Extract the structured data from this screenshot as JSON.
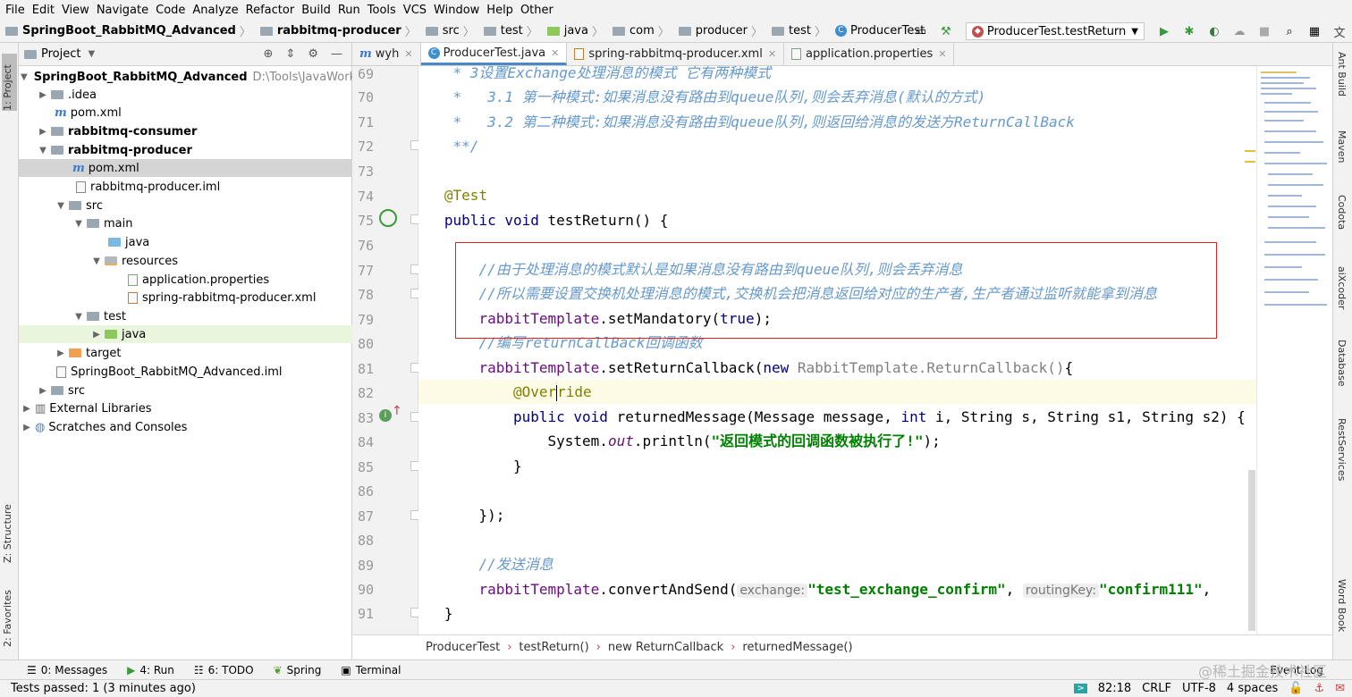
{
  "menu": [
    "File",
    "Edit",
    "View",
    "Navigate",
    "Code",
    "Analyze",
    "Refactor",
    "Build",
    "Run",
    "Tools",
    "VCS",
    "Window",
    "Help",
    "Other"
  ],
  "breadcrumbs": [
    "SpringBoot_RabbitMQ_Advanced",
    "rabbitmq-producer",
    "src",
    "test",
    "java",
    "com",
    "producer",
    "test",
    "ProducerTest"
  ],
  "run_config": "ProducerTest.testReturn",
  "project_panel": {
    "title": "Project",
    "tree": [
      {
        "label": "SpringBoot_RabbitMQ_Advanced",
        "path": "D:\\Tools\\JavaWorkSpa"
      },
      {
        "label": ".idea"
      },
      {
        "label": "pom.xml"
      },
      {
        "label": "rabbitmq-consumer"
      },
      {
        "label": "rabbitmq-producer"
      },
      {
        "label": "pom.xml"
      },
      {
        "label": "rabbitmq-producer.iml"
      },
      {
        "label": "src"
      },
      {
        "label": "main"
      },
      {
        "label": "java"
      },
      {
        "label": "resources"
      },
      {
        "label": "application.properties"
      },
      {
        "label": "spring-rabbitmq-producer.xml"
      },
      {
        "label": "test"
      },
      {
        "label": "java"
      },
      {
        "label": "target"
      },
      {
        "label": "SpringBoot_RabbitMQ_Advanced.iml"
      },
      {
        "label": "src"
      },
      {
        "label": "External Libraries"
      },
      {
        "label": "Scratches and Consoles"
      }
    ]
  },
  "left_tool_tabs": [
    "1: Project",
    "Z: Structure",
    "2: Favorites"
  ],
  "right_tool_tabs": [
    "Ant Build",
    "Maven",
    "Codota",
    "aiXcoder",
    "Database",
    "RestServices",
    "Word Book"
  ],
  "editor_tabs": [
    {
      "label": "wyh"
    },
    {
      "label": "ProducerTest.java"
    },
    {
      "label": "spring-rabbitmq-producer.xml"
    },
    {
      "label": "application.properties"
    }
  ],
  "line_numbers": [
    "69",
    "70",
    "71",
    "72",
    "73",
    "74",
    "75",
    "76",
    "77",
    "78",
    "79",
    "80",
    "81",
    "82",
    "83",
    "84",
    "85",
    "86",
    "87",
    "88",
    "89",
    "90",
    "91"
  ],
  "code": {
    "l69": "* 3设置Exchange处理消息的模式 它有两种模式",
    "l70": "*   3.1 第一种模式:如果消息没有路由到queue队列,则会丢弃消息(默认的方式)",
    "l71": "*   3.2 第二种模式:如果消息没有路由到queue队列,则返回给消息的发送方ReturnCallBack",
    "l72": "**/",
    "l74": "@Test",
    "l75_kw": "public void",
    "l75_rest": " testReturn() {",
    "l77": "//由于处理消息的模式默认是如果消息没有路由到queue队列,则会丢弃消息",
    "l78": "//所以需要设置交换机处理消息的模式,交换机会把消息返回给对应的生产者,生产者通过监听就能拿到消息",
    "l79_field": "rabbitTemplate",
    "l79_call": ".setMandatory(",
    "l79_kw": "true",
    "l79_end": ");",
    "l80": "//编写returnCallBack回调函数",
    "l81_field": "rabbitTemplate",
    "l81_call": ".setReturnCallback(",
    "l81_kw": "new",
    "l81_dim": " RabbitTemplate.ReturnCallback()",
    "l81_end": "{",
    "l82_a": "@Over",
    "l82_b": "ride",
    "l83_kw1": "public void",
    "l83_mid": " returnedMessage(Message message, ",
    "l83_kw2": "int",
    "l83_end": " i, String s, String s1, String s2) {",
    "l84_a": "System.",
    "l84_out": "out",
    "l84_b": ".println(",
    "l84_str": "\"返回模式的回调函数被执行了!\"",
    "l84_end": ");",
    "l85": "}",
    "l87": "});",
    "l89": "//发送消息",
    "l90_field": "rabbitTemplate",
    "l90_call": ".convertAndSend(",
    "l90_hint1": "exchange:",
    "l90_str1": "\"test_exchange_confirm\"",
    "l90_comma": ", ",
    "l90_hint2": "routingKey:",
    "l90_str2": "\"confirm111\"",
    "l90_end": ",",
    "l91": "}"
  },
  "editor_breadcrumb": [
    "ProducerTest",
    "testReturn()",
    "new ReturnCallback",
    "returnedMessage()"
  ],
  "tool_windows": [
    "0: Messages",
    "4: Run",
    "6: TODO",
    "Spring",
    "Terminal"
  ],
  "event_log": "Event Log",
  "status": {
    "message": "Tests passed: 1 (3 minutes ago)",
    "position": "82:18",
    "line_sep": "CRLF",
    "encoding": "UTF-8",
    "indent": "4 spaces"
  },
  "watermark": "@稀土掘金技术社区",
  "colors": {
    "accent": "#4a88c7",
    "highlight_box": "#e02020",
    "comment": "#6699cc",
    "string": "#008000",
    "keyword": "#000080"
  }
}
